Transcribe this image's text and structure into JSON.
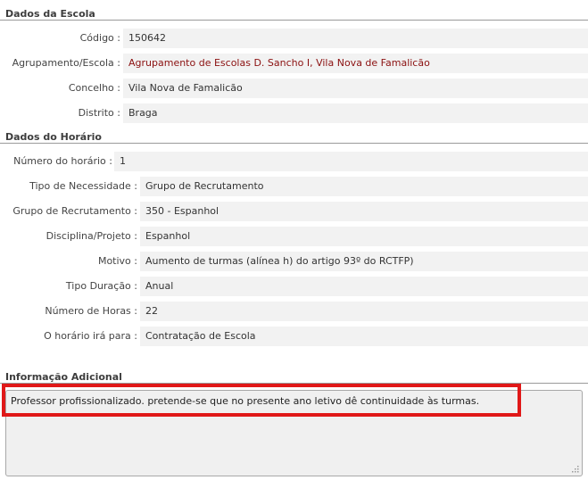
{
  "sections": {
    "school_title": "Dados da Escola",
    "horario_title": "Dados do Horário",
    "info_title": "Informação Adicional"
  },
  "school": {
    "rows": [
      {
        "label": "Código :",
        "value": "150642"
      },
      {
        "label": "Agrupamento/Escola :",
        "value": "Agrupamento de Escolas D. Sancho I, Vila Nova de Famalicão"
      },
      {
        "label": "Concelho :",
        "value": "Vila Nova de Famalicão"
      },
      {
        "label": "Distrito :",
        "value": "Braga"
      }
    ]
  },
  "horario": {
    "rows": [
      {
        "label": "Número do horário :",
        "value": "1"
      },
      {
        "label": "Tipo de Necessidade :",
        "value": "Grupo de Recrutamento"
      },
      {
        "label": "Grupo de Recrutamento :",
        "value": "350 - Espanhol"
      },
      {
        "label": "Disciplina/Projeto :",
        "value": "Espanhol"
      },
      {
        "label": "Motivo :",
        "value": "Aumento de turmas (alínea h) do artigo 93º do RCTFP)"
      },
      {
        "label": "Tipo Duração :",
        "value": "Anual"
      },
      {
        "label": "Número de Horas :",
        "value": "22"
      },
      {
        "label": "O horário irá para :",
        "value": "Contratação de Escola"
      }
    ]
  },
  "info": {
    "text": "Professor profissionalizado.  pretende-se que no presente ano letivo dê continuidade às turmas."
  },
  "colors": {
    "highlight": "#e01818",
    "school_link": "#8b1010",
    "value_bg": "#f2f2f2"
  },
  "icons": {
    "resize": "resize-grip-icon"
  }
}
